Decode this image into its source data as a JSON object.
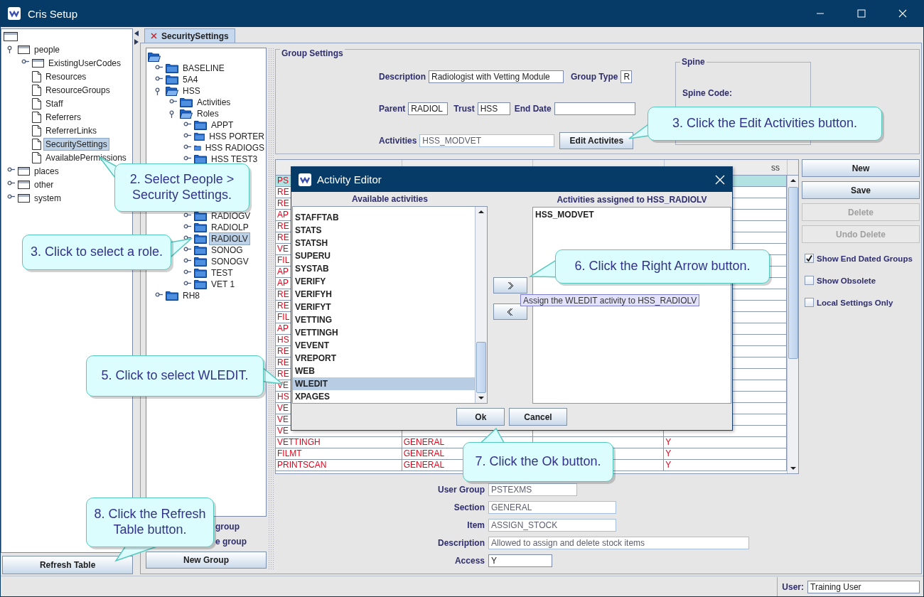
{
  "window": {
    "title": "Cris Setup"
  },
  "left_tree": {
    "items": [
      {
        "label": "people",
        "kind": "folder",
        "expanded": true,
        "selected": false,
        "children": [
          {
            "label": "ExistingUserCodes",
            "kind": "folder",
            "expanded": false,
            "selected": false
          },
          {
            "label": "Resources",
            "kind": "page",
            "selected": false
          },
          {
            "label": "ResourceGroups",
            "kind": "page",
            "selected": false
          },
          {
            "label": "Staff",
            "kind": "page",
            "selected": false
          },
          {
            "label": "Referrers",
            "kind": "page",
            "selected": false
          },
          {
            "label": "ReferrerLinks",
            "kind": "page",
            "selected": false
          },
          {
            "label": "SecuritySettings",
            "kind": "page",
            "selected": true
          },
          {
            "label": "AvailablePermissions",
            "kind": "page",
            "selected": false
          }
        ]
      },
      {
        "label": "places",
        "kind": "folder",
        "expanded": false,
        "selected": false
      },
      {
        "label": "other",
        "kind": "folder",
        "expanded": false,
        "selected": false
      },
      {
        "label": "system",
        "kind": "folder",
        "expanded": false,
        "selected": false
      }
    ]
  },
  "refresh_button": "Refresh Table",
  "tabs": [
    {
      "label": "SecuritySettings",
      "selected": true
    }
  ],
  "group_tree": {
    "items": [
      {
        "label": "BASELINE",
        "kind": "folder",
        "expanded": false,
        "selected": false
      },
      {
        "label": "5A4",
        "kind": "folder",
        "expanded": false,
        "selected": false
      },
      {
        "label": "HSS",
        "kind": "folder",
        "expanded": true,
        "selected": false,
        "children": [
          {
            "label": "Activities",
            "kind": "folder",
            "expanded": false,
            "selected": false
          },
          {
            "label": "Roles",
            "kind": "folder",
            "expanded": true,
            "selected": false,
            "children": [
              {
                "label": "APPT",
                "kind": "folder",
                "expanded": false,
                "selected": false
              },
              {
                "label": "HSS PORTER",
                "kind": "folder",
                "expanded": false,
                "selected": false
              },
              {
                "label": "HSS RADIOGS",
                "kind": "folder",
                "expanded": false,
                "selected": false
              },
              {
                "label": "HSS TEST3",
                "kind": "folder",
                "expanded": false,
                "selected": false
              },
              {
                "kind": "covered"
              },
              {
                "kind": "covered"
              },
              {
                "kind": "covered"
              },
              {
                "kind": "covered"
              },
              {
                "label": "RADIOGV",
                "kind": "folder",
                "expanded": false,
                "selected": false
              },
              {
                "label": "RADIOLP",
                "kind": "folder",
                "expanded": false,
                "selected": false
              },
              {
                "label": "RADIOLV",
                "kind": "folder",
                "expanded": false,
                "selected": true
              },
              {
                "label": "SONOG",
                "kind": "folder",
                "expanded": false,
                "selected": false
              },
              {
                "label": "SONOGV",
                "kind": "folder",
                "expanded": false,
                "selected": false
              },
              {
                "label": "TEST",
                "kind": "folder",
                "expanded": false,
                "selected": false
              },
              {
                "label": "VET 1",
                "kind": "folder",
                "expanded": false,
                "selected": false
              }
            ]
          }
        ]
      },
      {
        "label": "RH8",
        "kind": "folder",
        "expanded": false,
        "selected": false
      }
    ]
  },
  "group_options": [
    {
      "label": "group"
    },
    {
      "label": "e group"
    }
  ],
  "new_group_button": "New Group",
  "group_settings": {
    "title": "Group Settings",
    "description": {
      "label": "Description",
      "value": "Radiologist with Vetting Module"
    },
    "group_type": {
      "label": "Group Type",
      "value": "R"
    },
    "parent": {
      "label": "Parent",
      "value": "RADIOL"
    },
    "trust": {
      "label": "Trust",
      "value": "HSS"
    },
    "end_date": {
      "label": "End Date"
    },
    "activities": {
      "label": "Activities",
      "value": "HSS_MODVET",
      "disabled": true
    },
    "edit_button": "Edit Activites",
    "spine": {
      "title": "Spine",
      "code_label": "Spine Code:"
    }
  },
  "table": {
    "column_4": "ss",
    "rows": [
      {
        "column_1": "PS",
        "selected": true
      },
      {
        "column_1": "RE",
        "selected": false
      },
      {
        "column_1": "RE",
        "selected": false
      },
      {
        "column_1": "AP",
        "selected": false
      },
      {
        "column_1": "RE",
        "selected": false
      },
      {
        "column_1": "RE",
        "selected": false
      },
      {
        "column_1": "VE",
        "selected": false
      },
      {
        "column_1": "FIL",
        "selected": false
      },
      {
        "column_1": "AP",
        "selected": false
      },
      {
        "column_1": "AP",
        "selected": false
      },
      {
        "column_1": "RE",
        "selected": false
      },
      {
        "column_1": "RE",
        "selected": false
      },
      {
        "column_1": "FIL",
        "selected": false
      },
      {
        "column_1": "AP",
        "selected": false
      },
      {
        "column_1": "HS",
        "selected": false
      },
      {
        "column_1": "RE",
        "selected": false
      },
      {
        "column_1": "RE",
        "selected": false
      },
      {
        "column_1": "RE",
        "selected": false
      },
      {
        "column_1": "VE",
        "selected": false
      },
      {
        "column_1": "HS",
        "selected": false
      },
      {
        "column_1": "VE",
        "selected": false
      },
      {
        "column_1": "VE",
        "selected": false
      },
      {
        "column_1": "VE",
        "selected": false
      },
      {
        "column_1": "VETTINGH",
        "column_2": "GENERAL",
        "column_4": "Y",
        "selected": false
      },
      {
        "column_1": "FILMT",
        "column_2": "GENERAL",
        "column_4": "Y",
        "selected": false
      },
      {
        "column_1": "PRINTSCAN",
        "column_2": "GENERAL",
        "column_4": "Y",
        "selected": false
      }
    ]
  },
  "side_buttons": [
    {
      "label": "New",
      "disabled": false
    },
    {
      "label": "Save",
      "disabled": false
    },
    {
      "label": "Delete",
      "disabled": true
    },
    {
      "label": "Undo Delete",
      "disabled": true
    }
  ],
  "options": [
    {
      "label": "Show End Dated Groups",
      "checked": true
    },
    {
      "label": "Show Obsolete",
      "checked": false
    },
    {
      "label": "Local Settings Only",
      "checked": false
    }
  ],
  "detail_form": [
    {
      "label": "User Group",
      "value": "PSTEXMS",
      "disabled": true
    },
    {
      "label": "Section",
      "value": "GENERAL",
      "disabled": true
    },
    {
      "label": "Item",
      "value": "ASSIGN_STOCK",
      "disabled": true
    },
    {
      "label": "Description",
      "value": "Allowed to assign and delete stock items",
      "disabled": true
    },
    {
      "label": "Access",
      "value": "Y",
      "disabled": false
    }
  ],
  "status_bar": {
    "user_label": "User:",
    "user": "Training User"
  },
  "dialog": {
    "title": "Activity Editor",
    "available_header": "Available activities",
    "available": [
      {
        "label": "STAFFTAB",
        "selected": false
      },
      {
        "label": "STATS",
        "selected": false
      },
      {
        "label": "STATSH",
        "selected": false
      },
      {
        "label": "SUPERU",
        "selected": false
      },
      {
        "label": "SYSTAB",
        "selected": false
      },
      {
        "label": "VERIFY",
        "selected": false
      },
      {
        "label": "VERIFYH",
        "selected": false
      },
      {
        "label": "VERIFYT",
        "selected": false
      },
      {
        "label": "VETTING",
        "selected": false
      },
      {
        "label": "VETTINGH",
        "selected": false
      },
      {
        "label": "VEVENT",
        "selected": false
      },
      {
        "label": "VREPORT",
        "selected": false
      },
      {
        "label": "WEB",
        "selected": false
      },
      {
        "label": "WLEDIT",
        "selected": true
      },
      {
        "label": "XPAGES",
        "selected": false
      }
    ],
    "assigned_header": "Activities assigned to HSS_RADIOLV",
    "assigned": [
      {
        "label": "HSS_MODVET",
        "selected": false
      }
    ],
    "buttons": [
      "Ok",
      "Cancel"
    ],
    "tooltip": "Assign the WLEDIT activity to HSS_RADIOLV"
  },
  "callouts": [
    {
      "text": "2. Select People > Security Settings."
    },
    {
      "text": "3. Click to select a role."
    },
    {
      "text": "3. Click the Edit Activities button."
    },
    {
      "text": "5. Click to select WLEDIT."
    },
    {
      "text": "6. Click the Right Arrow button."
    },
    {
      "text": "7. Click the Ok button."
    },
    {
      "text": "8. Click the Refresh Table button."
    }
  ]
}
